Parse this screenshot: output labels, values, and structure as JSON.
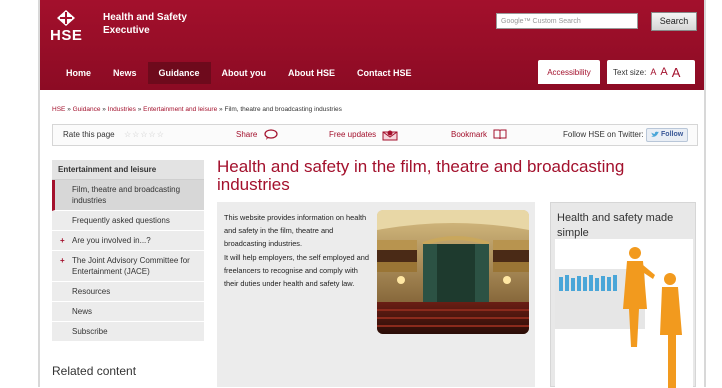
{
  "header": {
    "logo_text": "HSE",
    "org_name": "Health and Safety Executive",
    "search_placeholder": "Google™ Custom Search",
    "search_button": "Search"
  },
  "nav": {
    "items": [
      {
        "label": "Home"
      },
      {
        "label": "News"
      },
      {
        "label": "Guidance"
      },
      {
        "label": "About you"
      },
      {
        "label": "About HSE"
      },
      {
        "label": "Contact HSE"
      }
    ],
    "accessibility": "Accessibility",
    "text_size_label": "Text size:",
    "text_size_options": [
      "A",
      "A",
      "A"
    ]
  },
  "breadcrumb": {
    "links": [
      "HSE",
      "Guidance",
      "Industries",
      "Entertainment and leisure"
    ],
    "separator": "»",
    "current": "Film, theatre and broadcasting industries"
  },
  "tools": {
    "rate_label": "Rate this page",
    "share": "Share",
    "free_updates": "Free updates",
    "bookmark": "Bookmark",
    "follow_label": "Follow HSE on Twitter:",
    "follow_button": "Follow"
  },
  "sidenav": {
    "heading": "Entertainment and leisure",
    "items": [
      {
        "label": "Film, theatre and broadcasting industries"
      },
      {
        "label": "Frequently asked questions"
      },
      {
        "label": "Are you involved in...?"
      },
      {
        "label": "The Joint Advisory Committee for Entertainment (JACE)"
      },
      {
        "label": "Resources"
      },
      {
        "label": "News"
      },
      {
        "label": "Subscribe"
      }
    ],
    "related": "Related content"
  },
  "main": {
    "title": "Health and safety in the film, theatre and broadcasting industries",
    "intro_1": "This website provides information on health and safety in the film, theatre and broadcasting industries.",
    "intro_2": "It will help employers, the self employed and freelancers to recognise and comply with their duties under health and safety law."
  },
  "promo": {
    "title": "Health and safety made simple"
  },
  "colors": {
    "brand": "#a3102c",
    "nav_active": "#6e0a1c",
    "promo_orange": "#f29a1e",
    "promo_blue": "#4aa6d8"
  }
}
